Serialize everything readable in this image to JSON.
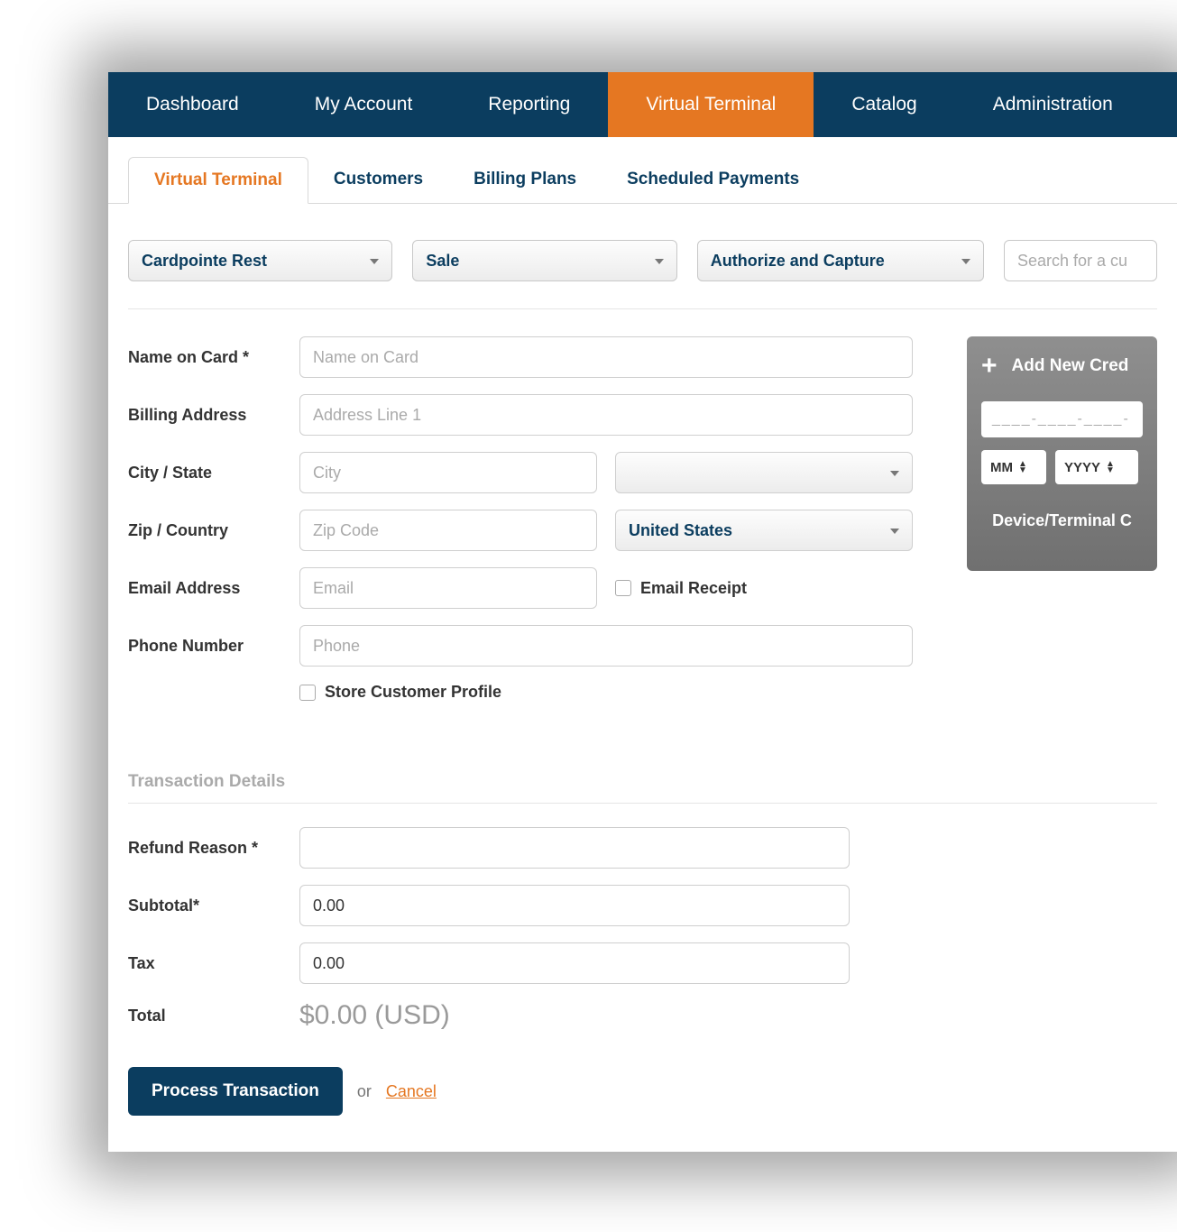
{
  "nav": {
    "items": [
      "Dashboard",
      "My Account",
      "Reporting",
      "Virtual Terminal",
      "Catalog",
      "Administration"
    ],
    "activeIndex": 3
  },
  "tabs": {
    "items": [
      "Virtual Terminal",
      "Customers",
      "Billing Plans",
      "Scheduled Payments"
    ],
    "activeIndex": 0
  },
  "filters": {
    "gateway": "Cardpointe Rest",
    "txntype": "Sale",
    "mode": "Authorize and Capture",
    "search_placeholder": "Search for a cu"
  },
  "form": {
    "name_label": "Name on Card *",
    "name_placeholder": "Name on Card",
    "addr_label": "Billing Address",
    "addr_placeholder": "Address Line 1",
    "citystate_label": "City / State",
    "city_placeholder": "City",
    "state_value": "",
    "zipcountry_label": "Zip / Country",
    "zip_placeholder": "Zip Code",
    "country_value": "United States",
    "email_label": "Email Address",
    "email_placeholder": "Email",
    "emailreceipt_label": "Email Receipt",
    "phone_label": "Phone Number",
    "phone_placeholder": "Phone",
    "store_label": "Store Customer Profile"
  },
  "card": {
    "title": "Add New Cred",
    "number_mask": "____-____-____-",
    "month": "MM",
    "year": "YYYY",
    "footer": "Device/Terminal C"
  },
  "transaction": {
    "section": "Transaction Details",
    "refund_label": "Refund Reason *",
    "subtotal_label": "Subtotal*",
    "subtotal_value": "0.00",
    "tax_label": "Tax",
    "tax_value": "0.00",
    "total_label": "Total",
    "total_value": "$0.00 (USD)"
  },
  "actions": {
    "process": "Process Transaction",
    "or": "or",
    "cancel": "Cancel"
  }
}
